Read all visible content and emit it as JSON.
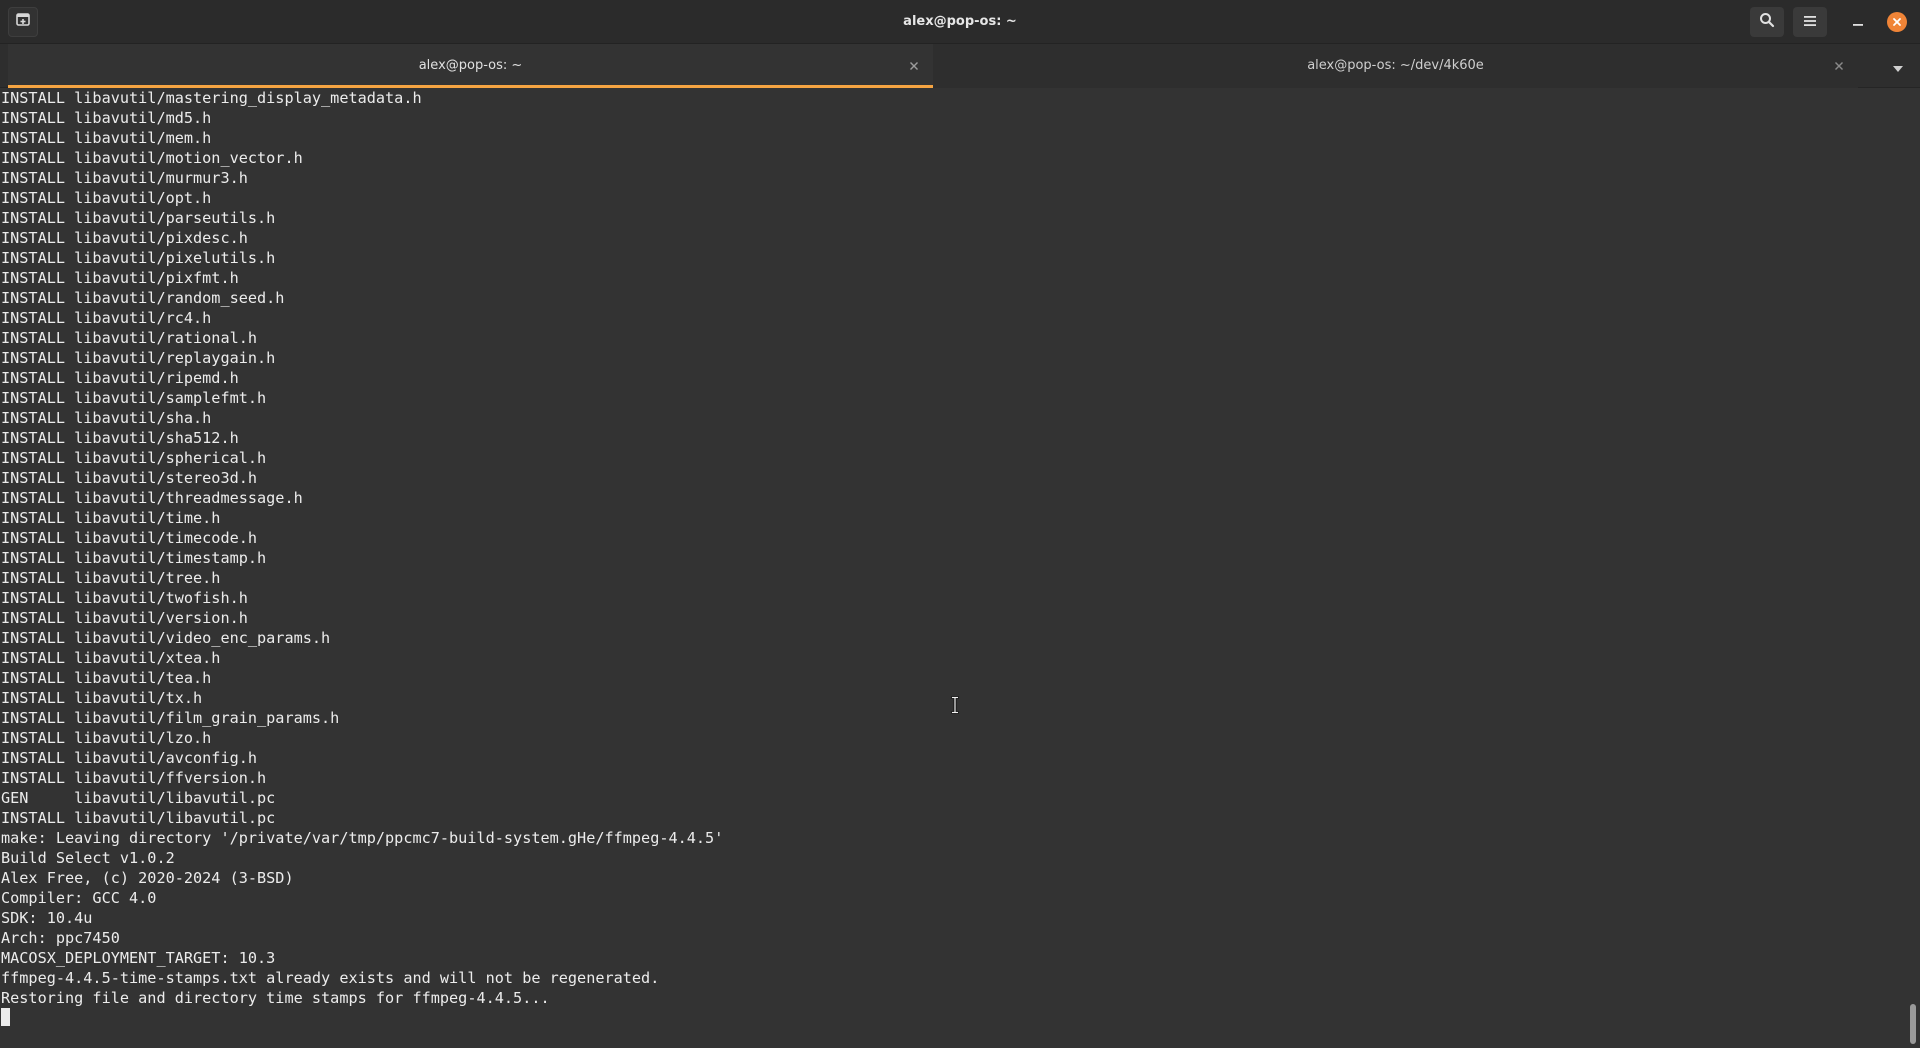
{
  "window": {
    "title": "alex@pop-os: ~"
  },
  "icons": {
    "new_tab": "new-tab-icon",
    "search": "search-icon",
    "menu": "hamburger-menu-icon",
    "minimize": "minimize-icon",
    "close": "close-icon",
    "tab_close": "close-icon",
    "tab_overflow": "chevron-down-icon"
  },
  "colors": {
    "accent": "#f5a442",
    "close_button": "#f08437",
    "terminal_bg": "#333333",
    "terminal_fg": "#ececec"
  },
  "tabs": [
    {
      "label": "alex@pop-os: ~",
      "active": true
    },
    {
      "label": "alex@pop-os: ~/dev/4k60e",
      "active": false
    }
  ],
  "terminal": {
    "lines": [
      "INSTALL libavutil/mastering_display_metadata.h",
      "INSTALL libavutil/md5.h",
      "INSTALL libavutil/mem.h",
      "INSTALL libavutil/motion_vector.h",
      "INSTALL libavutil/murmur3.h",
      "INSTALL libavutil/opt.h",
      "INSTALL libavutil/parseutils.h",
      "INSTALL libavutil/pixdesc.h",
      "INSTALL libavutil/pixelutils.h",
      "INSTALL libavutil/pixfmt.h",
      "INSTALL libavutil/random_seed.h",
      "INSTALL libavutil/rc4.h",
      "INSTALL libavutil/rational.h",
      "INSTALL libavutil/replaygain.h",
      "INSTALL libavutil/ripemd.h",
      "INSTALL libavutil/samplefmt.h",
      "INSTALL libavutil/sha.h",
      "INSTALL libavutil/sha512.h",
      "INSTALL libavutil/spherical.h",
      "INSTALL libavutil/stereo3d.h",
      "INSTALL libavutil/threadmessage.h",
      "INSTALL libavutil/time.h",
      "INSTALL libavutil/timecode.h",
      "INSTALL libavutil/timestamp.h",
      "INSTALL libavutil/tree.h",
      "INSTALL libavutil/twofish.h",
      "INSTALL libavutil/version.h",
      "INSTALL libavutil/video_enc_params.h",
      "INSTALL libavutil/xtea.h",
      "INSTALL libavutil/tea.h",
      "INSTALL libavutil/tx.h",
      "INSTALL libavutil/film_grain_params.h",
      "INSTALL libavutil/lzo.h",
      "INSTALL libavutil/avconfig.h",
      "INSTALL libavutil/ffversion.h",
      "GEN     libavutil/libavutil.pc",
      "INSTALL libavutil/libavutil.pc",
      "make: Leaving directory '/private/var/tmp/ppcmc7-build-system.gHe/ffmpeg-4.4.5'",
      "Build Select v1.0.2",
      "Alex Free, (c) 2020-2024 (3-BSD)",
      "Compiler: GCC 4.0",
      "SDK: 10.4u",
      "Arch: ppc7450",
      "MACOSX_DEPLOYMENT_TARGET: 10.3",
      "ffmpeg-4.4.5-time-stamps.txt already exists and will not be regenerated.",
      "Restoring file and directory time stamps for ffmpeg-4.4.5..."
    ],
    "cursor_line": ""
  }
}
